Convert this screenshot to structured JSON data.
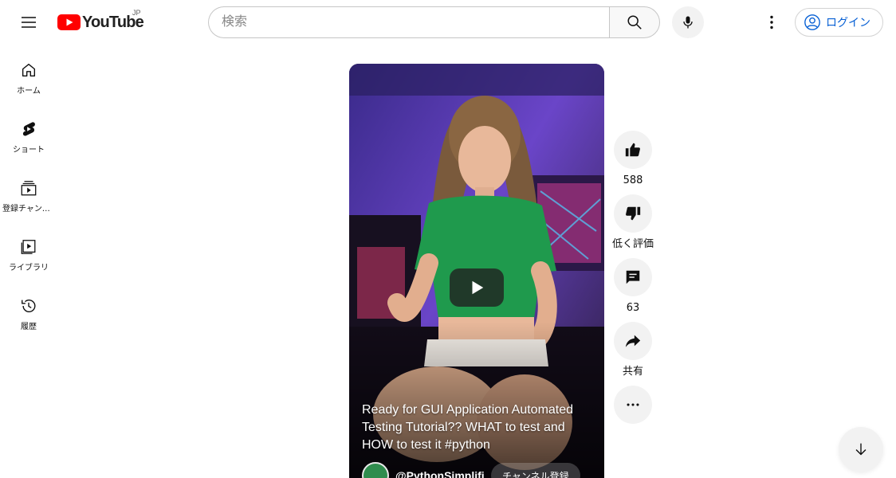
{
  "header": {
    "logo_text": "YouTube",
    "region": "JP",
    "search_placeholder": "検索",
    "login_label": "ログイン"
  },
  "sidebar": {
    "items": [
      {
        "label": "ホーム",
        "icon": "home-icon"
      },
      {
        "label": "ショート",
        "icon": "shorts-icon"
      },
      {
        "label": "登録チャンネル",
        "icon": "subscriptions-icon"
      },
      {
        "label": "ライブラリ",
        "icon": "library-icon"
      },
      {
        "label": "履歴",
        "icon": "history-icon"
      }
    ]
  },
  "video": {
    "title": "Ready for GUI Application Automated Testing Tutorial?? WHAT to test and HOW to test it #python",
    "channel": "@PythonSimplified",
    "subscribe_label": "チャンネル登録"
  },
  "actions": {
    "likes": "588",
    "dislike_label": "低く評価",
    "comments": "63",
    "share_label": "共有"
  },
  "colors": {
    "brand_red": "#ff0000",
    "link_blue": "#065fd4"
  }
}
